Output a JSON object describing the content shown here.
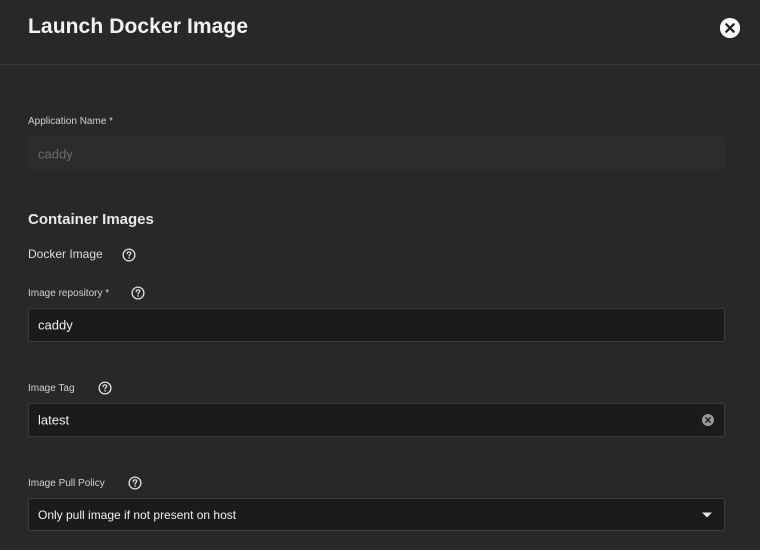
{
  "dialog": {
    "title": "Launch Docker Image",
    "close_icon": "close-circle-icon"
  },
  "app_name": {
    "label": "Application Name *",
    "value": "caddy",
    "disabled": true
  },
  "container_images": {
    "section_title": "Container Images",
    "docker_image_label": "Docker Image",
    "repository": {
      "label": "Image repository *",
      "value": "caddy"
    },
    "tag": {
      "label": "Image Tag",
      "value": "latest",
      "clear_icon": "clear-circle-icon"
    },
    "pull_policy": {
      "label": "Image Pull Policy",
      "selected": "Only pull image if not present on host",
      "caret_icon": "caret-down-icon"
    }
  },
  "colors": {
    "background": "#282828",
    "input_background": "#1b1b1b",
    "text": "#e6e6e6"
  }
}
